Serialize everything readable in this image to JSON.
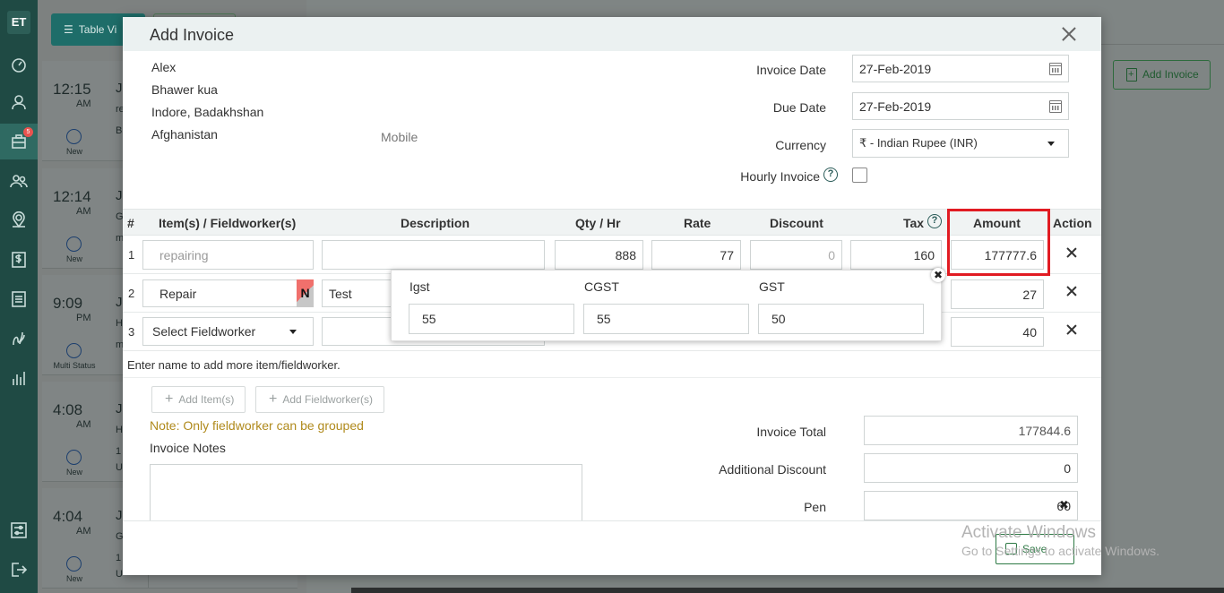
{
  "sidebar": {
    "logo": "ET",
    "badge": "5",
    "icons": [
      "dashboard-icon",
      "user-icon",
      "briefcase-icon",
      "users-icon",
      "map-pin-icon",
      "dollar-icon",
      "list-icon",
      "route-icon",
      "bar-chart-icon",
      "settings-sliders-icon",
      "logout-icon"
    ]
  },
  "background": {
    "table_view_label": "Table Vi",
    "add_invoice_label": "Add Invoice",
    "cards": [
      {
        "time": "12:15",
        "ampm": "AM",
        "status": "New",
        "c1": "Ji",
        "c2": "re",
        "c3": "B"
      },
      {
        "time": "12:14",
        "ampm": "AM",
        "status": "New",
        "c1": "Ji",
        "c2": "G",
        "c3": "m"
      },
      {
        "time": "9:09",
        "ampm": "PM",
        "status": "Multi Status",
        "c1": "Ji",
        "c2": "H",
        "c3": "m"
      },
      {
        "time": "4:08",
        "ampm": "AM",
        "status": "New",
        "c1": "Ji",
        "c2": "H",
        "c3": "1",
        "c4": "U"
      },
      {
        "time": "4:04",
        "ampm": "AM",
        "status": "New",
        "c1": "Ji",
        "c2": "G",
        "c3": "1",
        "c4": "U"
      }
    ]
  },
  "modal": {
    "title": "Add Invoice",
    "customer": {
      "name": "Alex",
      "line1": "Bhawer kua",
      "line2": "Indore, Badakhshan",
      "country": "Afghanistan",
      "mobile_label": "Mobile"
    },
    "invoice_date_label": "Invoice Date",
    "invoice_date": "27-Feb-2019",
    "due_date_label": "Due Date",
    "due_date": "27-Feb-2019",
    "currency_label": "Currency",
    "currency": "₹ - Indian Rupee (INR)",
    "hourly_label": "Hourly Invoice",
    "table": {
      "headers": {
        "num": "#",
        "item": "Item(s) / Fieldworker(s)",
        "description": "Description",
        "qty": "Qty / Hr",
        "rate": "Rate",
        "discount": "Discount",
        "tax": "Tax",
        "amount": "Amount",
        "action": "Action"
      },
      "rows": [
        {
          "num": "1",
          "item_placeholder": "repairing",
          "description": "",
          "qty": "888",
          "rate": "77",
          "discount": "0",
          "tax": "160",
          "amount": "177777.6"
        },
        {
          "num": "2",
          "item": "Repair",
          "badge": "N",
          "description": "Test",
          "amount": "27"
        },
        {
          "num": "3",
          "item": "Select Fieldworker",
          "amount": "40"
        }
      ],
      "add_hint": "Enter name to add more item/fieldworker."
    },
    "tax_popup": {
      "labels": [
        "Igst",
        "CGST",
        "GST"
      ],
      "values": [
        "55",
        "55",
        "50"
      ],
      "close": "✖"
    },
    "add_items_label": "Add Item(s)",
    "add_fieldworkers_label": "Add Fieldworker(s)",
    "note": "Note: Only fieldworker can be grouped",
    "notes_label": "Invoice Notes",
    "totals": {
      "invoice_total_label": "Invoice Total",
      "invoice_total": "177844.6",
      "additional_discount_label": "Additional Discount",
      "additional_discount": "0",
      "pen_label": "Pen",
      "pen": "60",
      "pen_remove": "✖"
    },
    "save_label": "Save"
  },
  "watermark": {
    "line1": "Activate Windows",
    "line2": "Go to Settings to activate Windows."
  }
}
